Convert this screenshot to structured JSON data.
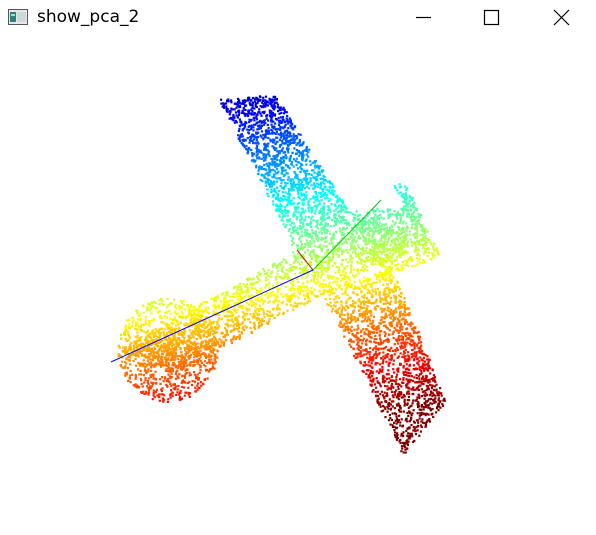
{
  "window": {
    "title": "show_pca_2",
    "icon": "python-window-icon",
    "controls": {
      "minimize": "minimize-icon",
      "maximize": "maximize-icon",
      "close": "close-icon"
    }
  },
  "viewer": {
    "content": "point-cloud-airplane",
    "colormap": "jet",
    "pca_axes": [
      {
        "color": "#0000ff"
      },
      {
        "color": "#00cc00"
      },
      {
        "color": "#cc0000"
      }
    ]
  }
}
